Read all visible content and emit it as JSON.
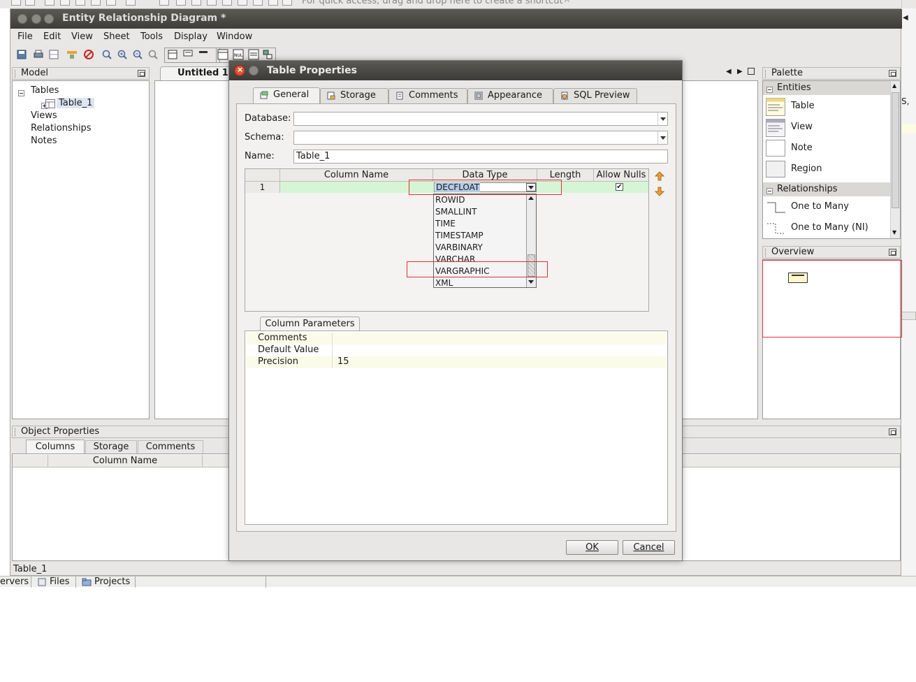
{
  "topstrip": {
    "quick_access_hint": "For quick access, drag and drop here to create a shortcut"
  },
  "window": {
    "title": "Entity Relationship Diagram *"
  },
  "menu": [
    "File",
    "Edit",
    "View",
    "Sheet",
    "Tools",
    "Display",
    "Window"
  ],
  "model_panel": {
    "title": "Model",
    "tree": {
      "tables": "Tables",
      "table_1": "Table_1",
      "views": "Views",
      "relationships": "Relationships",
      "notes": "Notes"
    }
  },
  "editor": {
    "tab": "Untitled 1"
  },
  "palette": {
    "title": "Palette",
    "entities_header": "Entities",
    "entities": [
      "Table",
      "View",
      "Note",
      "Region"
    ],
    "relationships_header": "Relationships",
    "relationships": [
      "One to Many",
      "One to Many (NI)"
    ]
  },
  "overview": {
    "title": "Overview"
  },
  "object_properties": {
    "title": "Object Properties",
    "tabs": [
      "Columns",
      "Storage",
      "Comments"
    ],
    "column_header": "Column Name"
  },
  "status": {
    "text": "Table_1"
  },
  "bottom_tabs": [
    "ervers",
    "Files",
    "Projects"
  ],
  "dialog": {
    "title": "Table Properties",
    "tabs": [
      "General",
      "Storage",
      "Comments",
      "Appearance",
      "SQL Preview"
    ],
    "database_label": "Database:",
    "schema_label": "Schema:",
    "name_label": "Name:",
    "name_value": "Table_1",
    "columns": [
      "Column Name",
      "Data Type",
      "Length",
      "Allow Nulls"
    ],
    "row": {
      "num": "1",
      "data_type": "DECFLOAT",
      "allow_nulls": "✔"
    },
    "dropdown_options": [
      "ROWID",
      "SMALLINT",
      "TIME",
      "TIMESTAMP",
      "VARBINARY",
      "VARCHAR",
      "VARGRAPHIC",
      "XML"
    ],
    "params_tab": "Column Parameters",
    "params": [
      {
        "label": "Comments",
        "value": ""
      },
      {
        "label": "Default Value",
        "value": ""
      },
      {
        "label": "Precision",
        "value": "15"
      }
    ],
    "ok": "OK",
    "cancel": "Cancel"
  },
  "colors": {
    "titlebar": "#4a4945",
    "row_highlight": "#d6f5d4",
    "annotation_red": "#e0303a"
  }
}
